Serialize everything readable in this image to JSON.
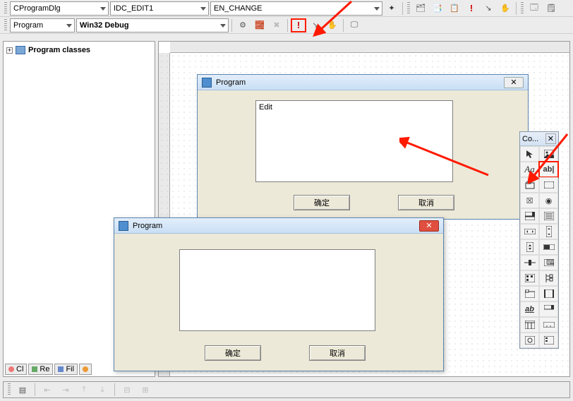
{
  "toolbar1": {
    "combo_class": "CProgramDlg",
    "combo_control": "IDC_EDIT1",
    "combo_event": "EN_CHANGE"
  },
  "toolbar2": {
    "combo_target": "Program",
    "combo_config": "Win32 Debug"
  },
  "tree": {
    "root_label": "Program classes",
    "expander": "+"
  },
  "tabs": {
    "t1": "Cl",
    "t2": "Re",
    "t3": "Fil"
  },
  "dialog_design": {
    "title": "Program",
    "edit_value": "Edit",
    "ok_label": "确定",
    "cancel_label": "取消",
    "close_glyph": "✕"
  },
  "dialog_run": {
    "title": "Program",
    "edit_value": "",
    "ok_label": "确定",
    "cancel_label": "取消",
    "close_glyph": "✕"
  },
  "controls_palette": {
    "title": "Co...",
    "close": "✕",
    "cells": {
      "pointer": "pointer-icon",
      "picture": "picture-icon",
      "static": "Aa",
      "edit": "ab|",
      "group": "group-box-icon",
      "button": "button-icon",
      "check": "☒",
      "radio": "◉",
      "combo": "combo-icon",
      "list": "list-icon",
      "hscroll": "hscroll-icon",
      "vscroll": "vscroll-icon",
      "spin": "spin-icon",
      "progress": "progress-icon",
      "slider": "slider-icon",
      "hotkey": "hotkey-icon",
      "listctrl": "listctrl-icon",
      "tree": "tree-icon",
      "tab": "tab-icon",
      "animate": "animate-icon",
      "richedit": "ab",
      "datetime": "datetime-icon",
      "month": "month-icon",
      "ip": "ip-icon",
      "custom": "custom-icon",
      "extended": "extended-icon"
    }
  },
  "arrows_color": "#ff1a00"
}
